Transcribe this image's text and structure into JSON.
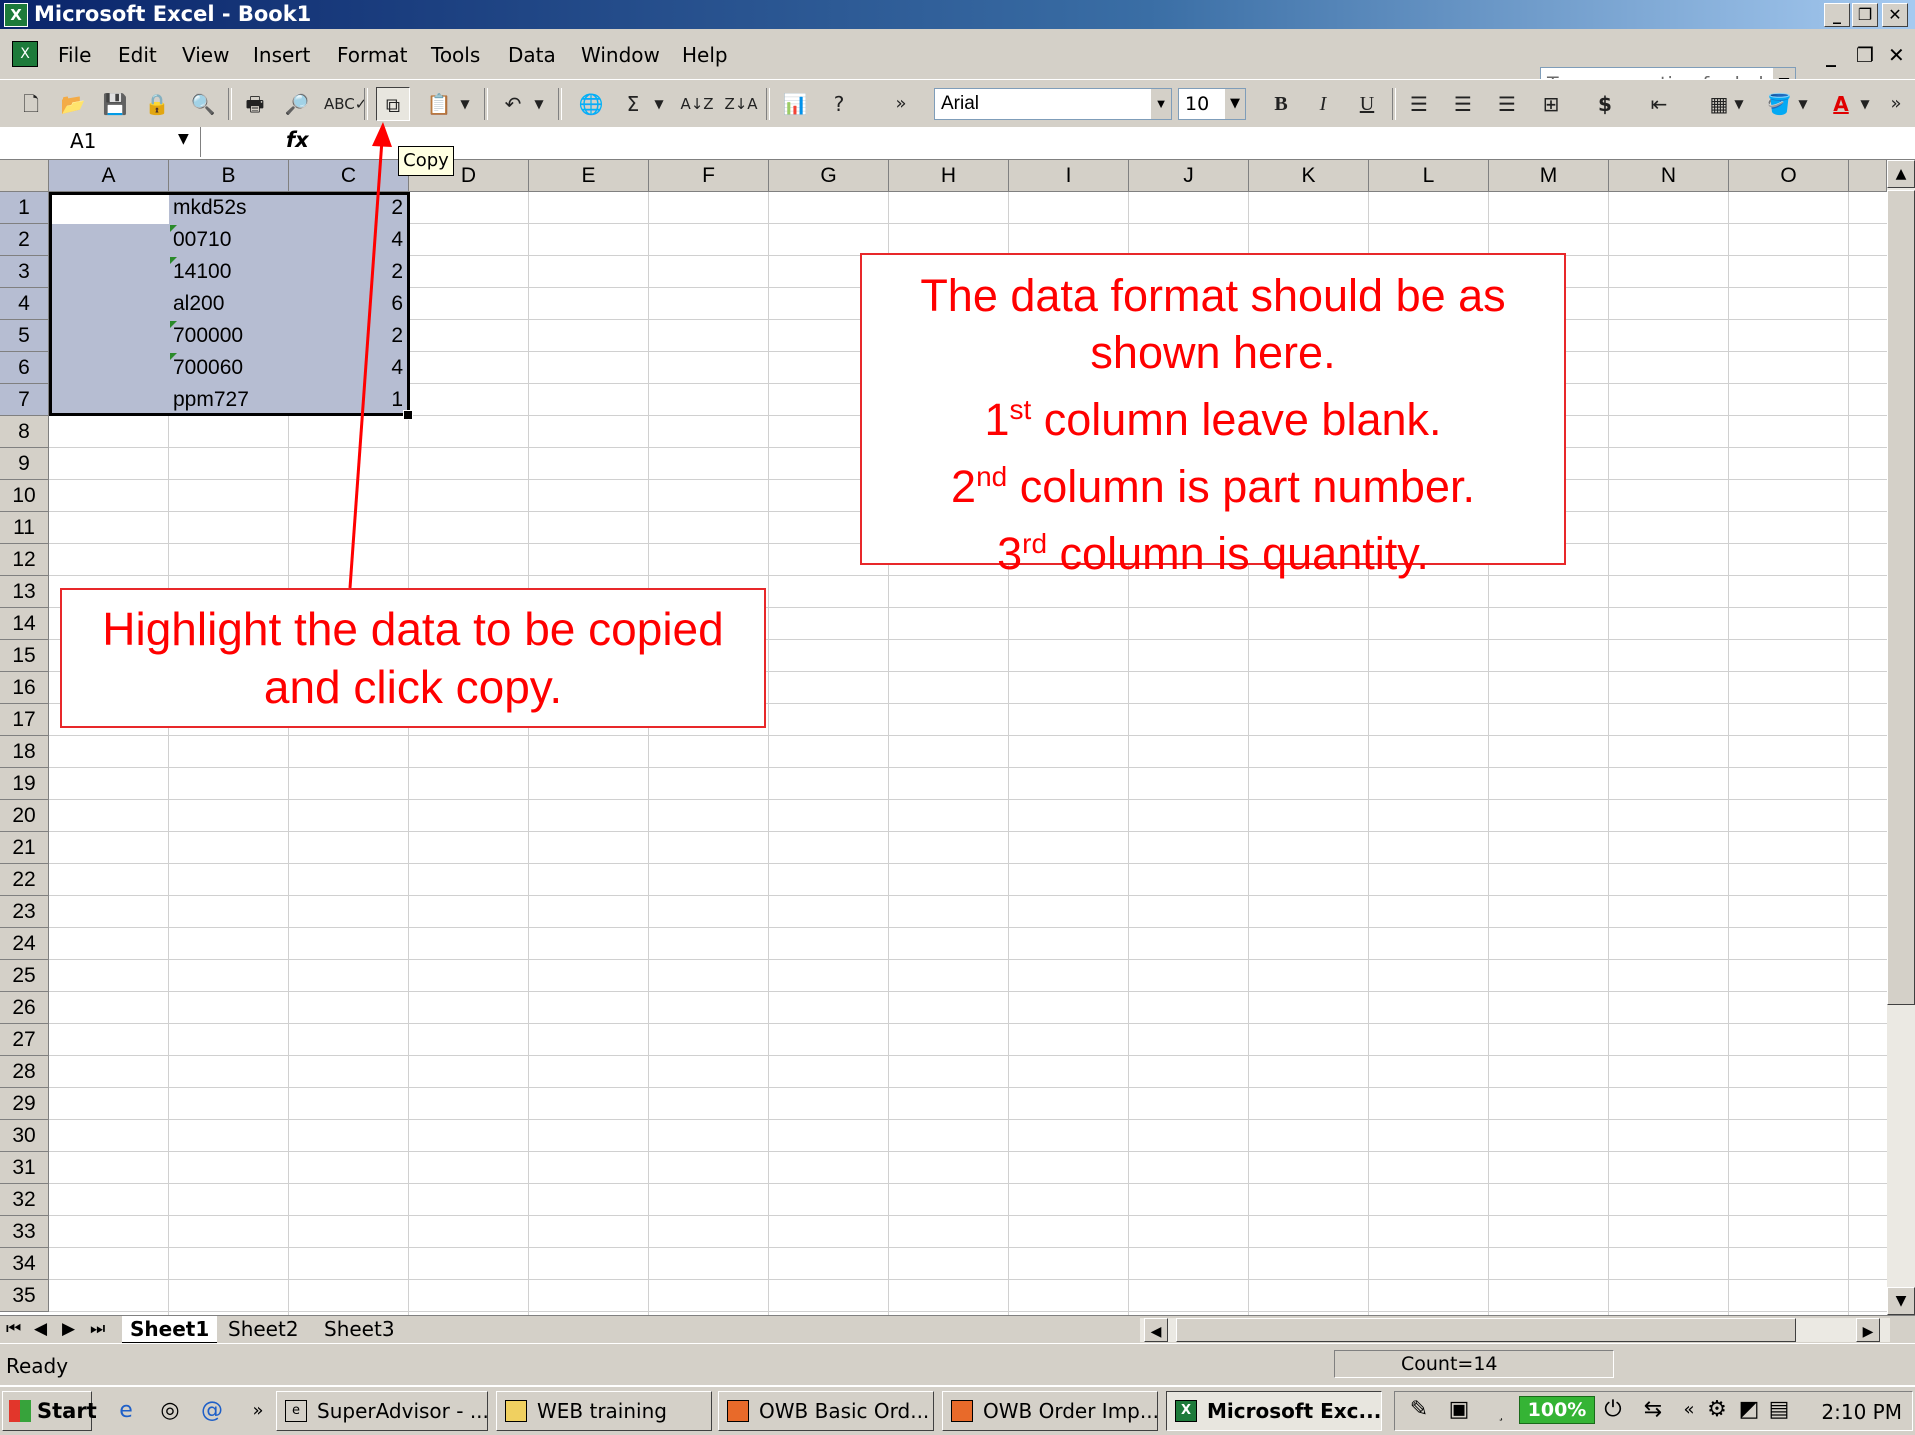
{
  "window": {
    "title": "Microsoft Excel - Book1",
    "buttons": [
      "_",
      "❐",
      "✕"
    ]
  },
  "menu": {
    "items": [
      "File",
      "Edit",
      "View",
      "Insert",
      "Format",
      "Tools",
      "Data",
      "Window",
      "Help"
    ],
    "help_placeholder": "Type a question for help"
  },
  "toolbar": {
    "font": "Arial",
    "font_size": "10",
    "tooltip": "Copy"
  },
  "formula_bar": {
    "name_box": "A1",
    "fx": "fx"
  },
  "columns": [
    "A",
    "B",
    "C",
    "D",
    "E",
    "F",
    "G",
    "H",
    "I",
    "J",
    "K",
    "L",
    "M",
    "N",
    "O"
  ],
  "rows": [
    "1",
    "2",
    "3",
    "4",
    "5",
    "6",
    "7",
    "8",
    "9",
    "10",
    "11",
    "12",
    "13",
    "14",
    "15",
    "16",
    "17",
    "18",
    "19",
    "20",
    "21",
    "22",
    "23",
    "24",
    "25",
    "26",
    "27",
    "28",
    "29",
    "30",
    "31",
    "32",
    "33",
    "34",
    "35"
  ],
  "cells": [
    {
      "part": "mkd52s",
      "qty": "2"
    },
    {
      "part": "00710",
      "qty": "4"
    },
    {
      "part": "14100",
      "qty": "2"
    },
    {
      "part": "al200",
      "qty": "6"
    },
    {
      "part": "700000",
      "qty": "2"
    },
    {
      "part": "700060",
      "qty": "4"
    },
    {
      "part": "ppm727",
      "qty": "1"
    }
  ],
  "sheets": [
    "Sheet1",
    "Sheet2",
    "Sheet3"
  ],
  "status": {
    "mode": "Ready",
    "count": "Count=14"
  },
  "callouts": {
    "format_line1": "The data format should be as",
    "format_line2": "shown here.",
    "col1_num": "1",
    "col1_sup": "st",
    "col1_text": " column leave blank.",
    "col2_num": "2",
    "col2_sup": "nd",
    "col2_text": " column is part number.",
    "col3_num": "3",
    "col3_sup": "rd",
    "col3_text": " column is quantity.",
    "highlight_line1": "Highlight the data to be copied",
    "highlight_line2": "and click copy."
  },
  "taskbar": {
    "start": "Start",
    "tasks": [
      "SuperAdvisor - ...",
      "WEB training",
      "OWB Basic Ord...",
      "OWB Order Imp...",
      "Microsoft Exc..."
    ],
    "zoom": "100%",
    "time": "2:10 PM"
  },
  "colors": {
    "callout_red": "#ff0000",
    "selection": "#b6bdd2",
    "titlebar": "#0a246a"
  }
}
